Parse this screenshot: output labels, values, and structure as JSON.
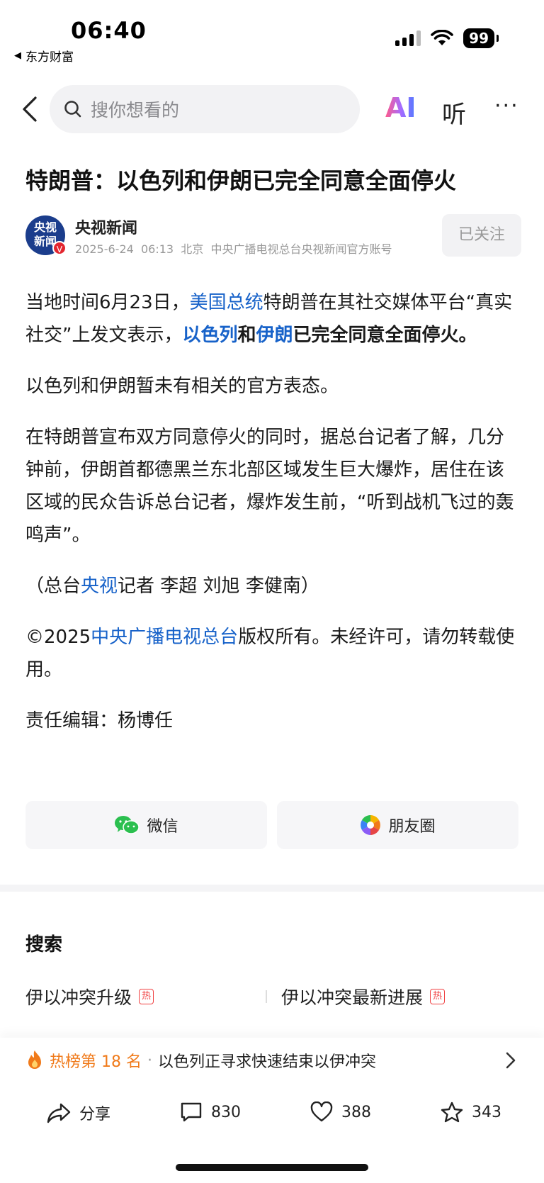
{
  "status_bar": {
    "time": "06:40",
    "back_app": "东方财富",
    "battery": "99"
  },
  "nav": {
    "search_placeholder": "搜你想看的",
    "ai_label": "AI",
    "listen_label": "听",
    "more_label": "···"
  },
  "article": {
    "title": "特朗普：以色列和伊朗已完全同意全面停火",
    "author": {
      "avatar_text_line1": "央视",
      "avatar_text_line2": "新闻",
      "verified": "V",
      "name": "央视新闻",
      "date": "2025-6-24",
      "time": "06:13",
      "location": "北京",
      "description": "中央广播电视总台央视新闻官方账号",
      "follow_label": "已关注"
    },
    "p1": {
      "a": "当地时间6月23日，",
      "link1": "美国总统",
      "b": "特朗普在其社交媒体平台“真实社交”上发文表示，",
      "link2": "以色列",
      "c": "和",
      "link3": "伊朗",
      "d": "已完全同意全面停火。"
    },
    "p2": "以色列和伊朗暂未有相关的官方表态。",
    "p3": "在特朗普宣布双方同意停火的同时，据总台记者了解，几分钟前，伊朗首都德黑兰东北部区域发生巨大爆炸，居住在该区域的民众告诉总台记者，爆炸发生前，“听到战机飞过的轰鸣声”。",
    "p4": {
      "a": "（总台",
      "link": "央视",
      "b": "记者 李超 刘旭 李健南）"
    },
    "p5": {
      "a": "©2025",
      "link": "中央广播电视总台",
      "b": "版权所有。未经许可，请勿转载使用。"
    },
    "editor": "责任编辑：杨博任"
  },
  "share": {
    "wechat_label": "微信",
    "moments_label": "朋友圈"
  },
  "search_section": {
    "title": "搜索",
    "items": [
      {
        "label": "伊以冲突升级",
        "tag": "热"
      },
      {
        "label": "伊以冲突最新进展",
        "tag": "热"
      }
    ]
  },
  "hot_rank": {
    "label": "热榜第 18 名",
    "separator": "·",
    "text": "以色列正寻求快速结束以伊冲突"
  },
  "actions": {
    "share_label": "分享",
    "comment_count": "830",
    "like_count": "388",
    "favorite_count": "343"
  },
  "colors": {
    "link_blue": "#1762c9",
    "hot_orange": "#f07a1a",
    "hot_tag_red": "#f04142",
    "avatar_blue": "#1b3d8c"
  }
}
